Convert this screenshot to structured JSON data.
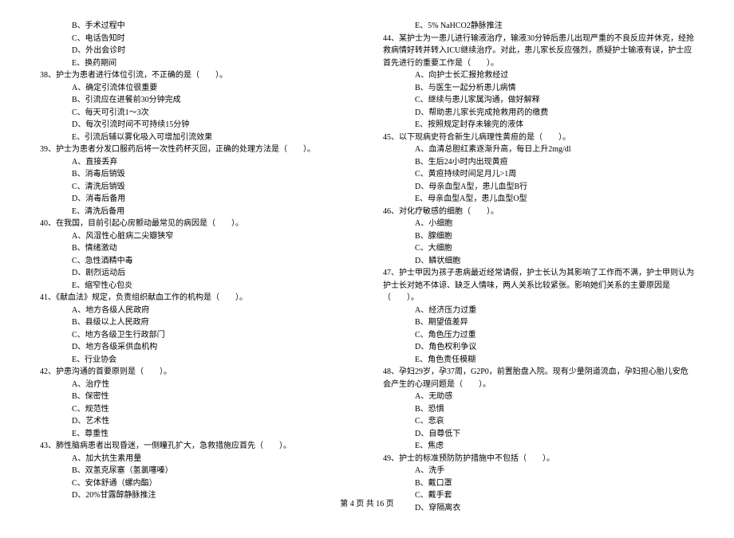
{
  "left": {
    "q37opts": [
      "B、手术过程中",
      "C、电话告知时",
      "D、外出会诊时",
      "E、换药期间"
    ],
    "q38": "38、护士为患者进行体位引流，不正确的是（　　）。",
    "q38opts": [
      "A、确定引流体位很重要",
      "B、引流应在进餐前30分钟完成",
      "C、每天可引流1～3次",
      "D、每次引流时间不可持续15分钟",
      "E、引流后辅以雾化吸入可增加引流效果"
    ],
    "q39": "39、护士为患者分发口服药后将一次性药杯灭回，正确的处理方法是（　　）。",
    "q39opts": [
      "A、直接丢弃",
      "B、消毒后销毁",
      "C、清洗后销毁",
      "D、消毒后备用",
      "E、清洗后备用"
    ],
    "q40": "40、在我国，目前引起心房颤动最常见的病因是（　　）。",
    "q40opts": [
      "A、风湿性心脏病二尖瓣狭窄",
      "B、情绪激动",
      "C、急性酒精中毒",
      "D、剧烈运动后",
      "E、缩窄性心包炎"
    ],
    "q41": "41、《献血法》规定，负责组织献血工作的机构是（　　）。",
    "q41opts": [
      "A、地方各级人民政府",
      "B、县级以上人民政府",
      "C、地方各级卫生行政部门",
      "D、地方各级采供血机构",
      "E、行业协会"
    ],
    "q42": "42、护患沟通的首要原则是（　　）。",
    "q42opts": [
      "A、治疗性",
      "B、保密性",
      "C、规范性",
      "D、艺术性",
      "E、尊重性"
    ],
    "q43": "43、肺性脑病患者出现昏迷，一侧瞳孔扩大，急救措施应首先（　　）。",
    "q43opts": [
      "A、加大抗生素用量",
      "B、双氢克尿塞（氢氯噻嗪）",
      "C、安体舒通（螺内酯）",
      "D、20%甘露醇静脉推注"
    ]
  },
  "right": {
    "q43e": "E、5% NaHCO2静脉推注",
    "q44": "44、某护士为一患儿进行输液治疗，输液30分钟后患儿出现严重的不良反应并休克，经抢救病情好转并转入ICU继续治疗。对此，患儿家长反应强烈，质疑护士输液有误，护士应首先进行的重要工作是（　　）。",
    "q44opts": [
      "A、向护士长汇报抢救经过",
      "B、与医生一起分析患儿病情",
      "C、继续与患儿家属沟通，做好解释",
      "D、帮助患儿家长完成抢救用药的缴费",
      "E、按照规定封存未输完的液体"
    ],
    "q45": "45、以下现病史符合新生儿病理性黄疸的是（　　）。",
    "q45opts": [
      "A、血清总胆红素逐渐升高，每日上升2mg/dl",
      "B、生后24小时内出现黄疸",
      "C、黄疸持续时间足月儿>1周",
      "D、母亲血型A型，患儿血型B行",
      "E、母亲血型A型，患儿血型O型"
    ],
    "q46": "46、对化疗敏感的细胞（　　）。",
    "q46opts": [
      "A、小细胞",
      "B、腺细胞",
      "C、大细胞",
      "D、鳞状细胞"
    ],
    "q47": "47、护士甲因为孩子患病最近经常请假，护士长认为其影响了工作而不满，护士甲则认为护士长对她不体谅、缺乏人情味，两人关系比较紧张。影响她们关系的主要原因是（　　）。",
    "q47opts": [
      "A、经济压力过重",
      "B、期望值差异",
      "C、角色压力过重",
      "D、角色权利争议",
      "E、角色责任模糊"
    ],
    "q48": "48、孕妇29岁，孕37周，G2P0，前置胎盘入院。现有少量阴道流血，孕妇担心胎儿安危会产生的心理问题是（　　）。",
    "q48opts": [
      "A、无助感",
      "B、恐惧",
      "C、悲哀",
      "D、自尊低下",
      "E、焦虑"
    ],
    "q49": "49、护士的标准预防防护措施中不包括（　　）。",
    "q49opts": [
      "A、洗手",
      "B、戴口罩",
      "C、戴手套",
      "D、穿隔离衣"
    ]
  },
  "footer": "第 4 页 共 16 页"
}
